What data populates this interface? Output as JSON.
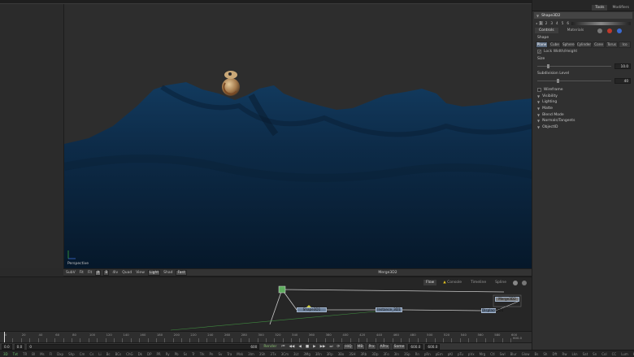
{
  "inspector": {
    "tabs": [
      "Tools",
      "Modifiers"
    ],
    "active_tab": "Tools",
    "node_name": "Shape3D2",
    "versions": [
      "1",
      "2",
      "3",
      "4",
      "5",
      "6"
    ],
    "subtabs": [
      "Controls",
      "Materials"
    ],
    "shape_label": "Shape",
    "shape_buttons": [
      "Plane",
      "Cube",
      "Sphere",
      "Cylinder",
      "Cone",
      "Torus",
      "Ico"
    ],
    "active_shape": "Plane",
    "lock_label": "Lock Width/Height",
    "size_label": "Size",
    "size_value": "10.0",
    "subdiv_label": "Subdivision Level",
    "subdiv_value": "40",
    "groups": [
      "Wireframe",
      "Visibility",
      "Lighting",
      "Matte",
      "Blend Mode",
      "Normals/Tangents",
      "ObjectID"
    ]
  },
  "viewer": {
    "view_label": "Perspective",
    "title": "Merge3D2",
    "toolbar_items": [
      "SubV",
      "Fit",
      "Fit",
      "A",
      "B",
      "4lv",
      "Quad",
      "View",
      "Light",
      "Shad",
      "Fast"
    ]
  },
  "flow": {
    "tabs": [
      "Flow",
      "Console",
      "Timeline",
      "Spline"
    ],
    "active_tab": "Flow",
    "nodes": [
      "Shape3D1",
      "Instance_3D1",
      "Displace3D1",
      "Merge3D2"
    ]
  },
  "timeline": {
    "ticks": [
      "0",
      "10",
      "20",
      "30",
      "40",
      "50",
      "60",
      "70",
      "80",
      "90",
      "100",
      "110",
      "120",
      "130",
      "140",
      "150",
      "160",
      "170",
      "180",
      "190",
      "200",
      "210",
      "220",
      "230",
      "240",
      "250",
      "260",
      "270",
      "280",
      "290",
      "300",
      "310",
      "320",
      "330",
      "340",
      "350",
      "360",
      "370",
      "380",
      "390",
      "400",
      "410",
      "420",
      "430",
      "440",
      "450",
      "460",
      "470",
      "480",
      "490",
      "500",
      "510",
      "520",
      "530",
      "540",
      "550",
      "560",
      "570",
      "580",
      "590",
      "600"
    ],
    "end_value": "600.0"
  },
  "transport": {
    "start": "0.0",
    "current": "0.0",
    "zero": "0",
    "range_end": "600",
    "render_label": "Render",
    "hiq": "HiQ",
    "mb": "MB",
    "prx": "Prx",
    "aprx": "APrx",
    "some": "Some",
    "end": "600.0",
    "end2": "600.0"
  },
  "bottom_tools": [
    "3D",
    "Txt",
    "TR",
    "Bl",
    "Ms",
    "Fl",
    "Dxp",
    "Shp",
    "Cm",
    "Cs",
    "Li",
    "Bc",
    "BCs",
    "ChG",
    "Dk",
    "DP",
    "PR",
    "Ry",
    "Pb",
    "Ss",
    "Tr",
    "Trk",
    "Pn",
    "Sv",
    "Tra",
    "Msk",
    "3Im",
    "3Sh",
    "3Tx",
    "3Cm",
    "3Lt",
    "3Mg",
    "3Rn",
    "3Rp",
    "3Bo",
    "3SH",
    "3Rb",
    "3Dp",
    "3Fo",
    "3In",
    "3Sp",
    "Rn",
    "pRn",
    "pEm",
    "pKl",
    "pTu",
    "pVx",
    "Mrg",
    "Ctl",
    "Swl",
    "Blur",
    "Glow",
    "Bs",
    "Sh",
    "Dft",
    "Rw",
    "Lkn",
    "Sat",
    "Sn",
    "Col",
    "CC",
    "Lum",
    "Hsl",
    "Dc",
    "Ms",
    "Luma",
    "FL"
  ],
  "colors": {
    "terrain": "#0d2a45",
    "accent": "#5b6b80",
    "node": "#6b7f99"
  }
}
